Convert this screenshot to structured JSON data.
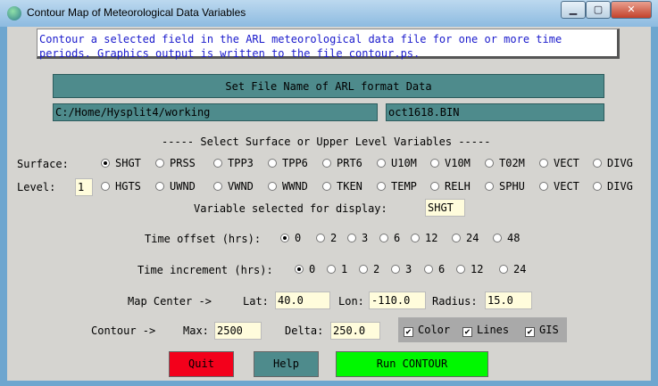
{
  "window": {
    "title": "Contour Map of Meteorological Data Variables",
    "min_glyph": "▁",
    "max_glyph": "▢",
    "close_glyph": "✕"
  },
  "info": {
    "text": "Contour a selected field in the ARL meteorological data file for one or more time\nperiods. Graphics output is written to the file contour.ps."
  },
  "file": {
    "button_label": "Set File Name of ARL format Data",
    "directory": "C:/Home/Hysplit4/working",
    "filename": "oct1618.BIN"
  },
  "vars": {
    "header": "----- Select Surface or Upper Level Variables -----",
    "surface_label": "Surface:",
    "surface_options": [
      "SHGT",
      "PRSS",
      "TPP3",
      "TPP6",
      "PRT6",
      "U10M",
      "V10M",
      "T02M",
      "VECT",
      "DIVG"
    ],
    "level_label": "Level:",
    "level_value": "1",
    "upper_options": [
      "HGTS",
      "UWND",
      "VWND",
      "WWND",
      "TKEN",
      "TEMP",
      "RELH",
      "SPHU",
      "VECT",
      "DIVG"
    ],
    "selected_label": "Variable selected for display:",
    "selected_value": "SHGT"
  },
  "time_offset": {
    "label": "Time offset (hrs):",
    "options": [
      "0",
      "2",
      "3",
      "6",
      "12",
      "24",
      "48"
    ]
  },
  "time_increment": {
    "label": "Time increment (hrs):",
    "options": [
      "0",
      "1",
      "2",
      "3",
      "6",
      "12",
      "24"
    ]
  },
  "map_center": {
    "label": "Map Center ->",
    "lat_label": "Lat:",
    "lat": "40.0",
    "lon_label": "Lon:",
    "lon": "-110.0",
    "radius_label": "Radius:",
    "radius": "15.0"
  },
  "contour": {
    "label": "Contour ->",
    "max_label": "Max:",
    "max": "2500",
    "delta_label": "Delta:",
    "delta": "250.0",
    "color_label": "Color",
    "lines_label": "Lines",
    "gis_label": "GIS",
    "check_glyph": "✔"
  },
  "buttons": {
    "quit": "Quit",
    "help": "Help",
    "run": "Run CONTOUR"
  },
  "colors": {
    "teal": "#4e8b8c",
    "quit": "#f3001b",
    "run": "#00f800",
    "info_text": "#1a1acc",
    "entry_bg": "#fffcdc",
    "panel": "#d5d4d0"
  }
}
